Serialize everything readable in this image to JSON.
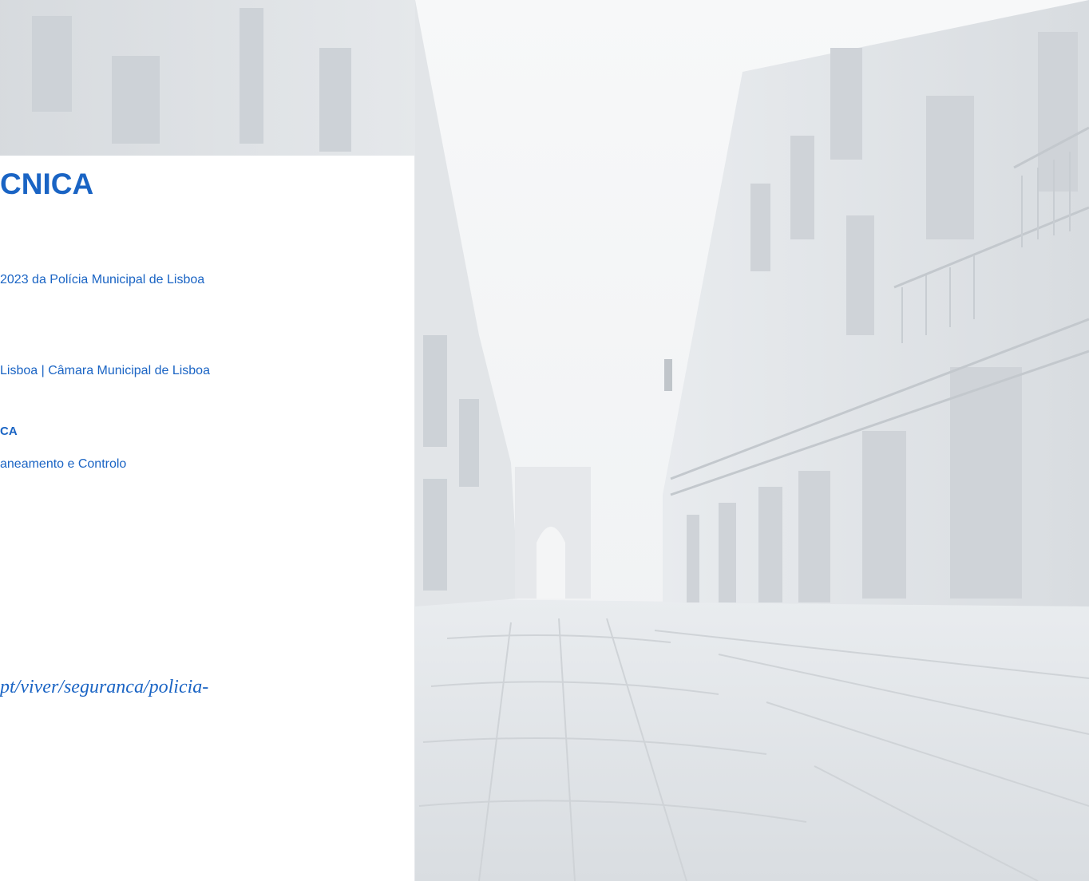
{
  "page": {
    "heading": "CNICA",
    "lines": [
      "2023 da Polícia Municipal de Lisboa",
      "Lisboa | Câmara Municipal de Lisboa",
      "CA",
      "aneamento e Controlo"
    ],
    "url_fragment": "pt/viver/seguranca/policia-"
  },
  "colors": {
    "accent": "#1a64c4",
    "panel_background": "#ffffff",
    "photo_tint": "#dfe2e6"
  }
}
